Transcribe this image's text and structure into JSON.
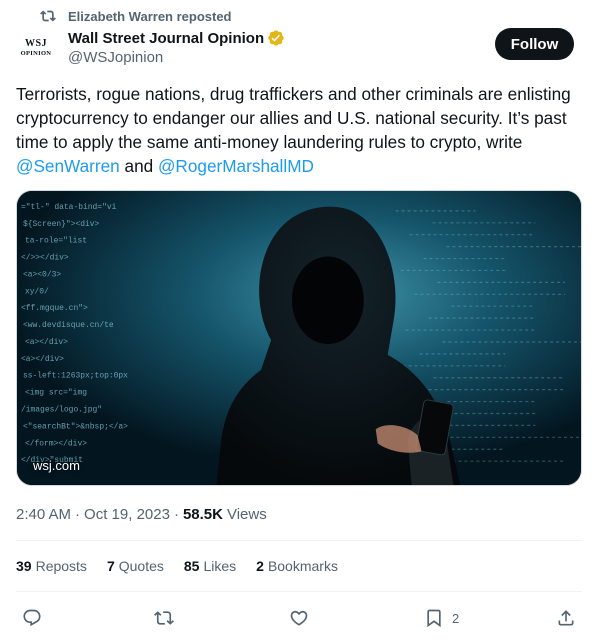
{
  "repost": {
    "label": "Elizabeth Warren reposted"
  },
  "author": {
    "avatar_line1": "WSJ",
    "avatar_line2": "OPINION",
    "name": "Wall Street Journal Opinion",
    "handle": "@WSJopinion",
    "verified_color": "#e2b719"
  },
  "follow_label": "Follow",
  "tweet": {
    "text_part1": "Terrorists, rogue nations, drug traffickers and other criminals are enlisting cryptocurrency to endanger our allies and U.S. national security. It’s past time to apply the same anti-money laundering rules to crypto, write ",
    "mention1": "@SenWarren",
    "text_part2": " and ",
    "mention2": "@RogerMarshallMD"
  },
  "media": {
    "domain": "wsj.com",
    "code_lines": [
      "=\"tl-\" data-bind=\"vi",
      "${Screen}\"><div>",
      "ta-role=\"list",
      "</>></div>",
      "<a><0/3>",
      "xy/0/",
      "<ff.mgque.cn\">",
      "<ww.devdisque.cn/te",
      "<a></div>",
      "<a></div>",
      "ss-left:1263px;top:0px",
      "<img src=\"img",
      "/images/logo.jpg\"",
      "<\"searchBt\">&nbsp;</a>",
      "</form></div>",
      "</div>\"submit"
    ]
  },
  "meta": {
    "time": "2:40 AM",
    "date": "Oct 19, 2023",
    "views_count": "58.5K",
    "views_label": "Views"
  },
  "stats": {
    "reposts_count": "39",
    "reposts_label": "Reposts",
    "quotes_count": "7",
    "quotes_label": "Quotes",
    "likes_count": "85",
    "likes_label": "Likes",
    "bookmarks_count": "2",
    "bookmarks_label": "Bookmarks"
  },
  "actions": {
    "reply_icon": "reply-icon",
    "repost_icon": "repost-icon",
    "like_icon": "heart-icon",
    "bookmark_icon": "bookmark-icon",
    "bookmark_count": "2",
    "share_icon": "share-icon"
  }
}
